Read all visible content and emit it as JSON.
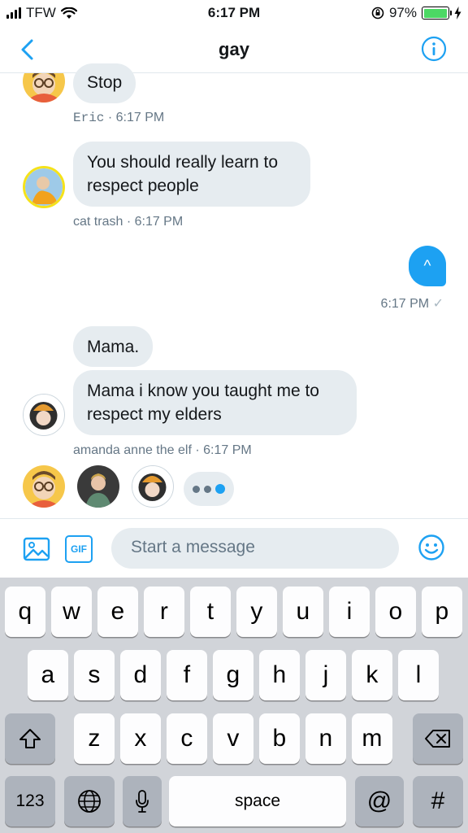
{
  "status_bar": {
    "carrier": "TFW",
    "time": "6:17 PM",
    "battery_percent": "97%",
    "battery_level": 0.97
  },
  "nav": {
    "title": "gay",
    "back_icon": "chevron-left-icon",
    "info_icon": "info-icon"
  },
  "messages": [
    {
      "text": "Stop",
      "sender_meta": "Eric",
      "time": "6:17 PM"
    },
    {
      "text": "You should really learn to respect people",
      "sender_meta": "cat trash",
      "time": "6:17 PM"
    },
    {
      "text": "^",
      "time": "6:17 PM",
      "status_icon": "checkmark-icon"
    },
    {
      "text": "Mama.",
      "sender_meta": "",
      "time": ""
    },
    {
      "text": "Mama i know you taught me to respect my elders",
      "sender_meta": "amanda anne the elf",
      "time": "6:17 PM"
    }
  ],
  "meta_separator": "·",
  "read_check": "✓",
  "composer": {
    "placeholder": "Start a message",
    "gif_label": "GIF"
  },
  "keyboard": {
    "row1": [
      "q",
      "w",
      "e",
      "r",
      "t",
      "y",
      "u",
      "i",
      "o",
      "p"
    ],
    "row2": [
      "a",
      "s",
      "d",
      "f",
      "g",
      "h",
      "j",
      "k",
      "l"
    ],
    "row3": [
      "z",
      "x",
      "c",
      "v",
      "b",
      "n",
      "m"
    ],
    "numbers_key": "123",
    "space_key": "space",
    "at_key": "@",
    "hash_key": "#"
  },
  "colors": {
    "accent": "#1da1f2",
    "bubble_in": "#e6ecf0",
    "meta_text": "#657786",
    "keyboard_bg": "#d1d4d9"
  }
}
